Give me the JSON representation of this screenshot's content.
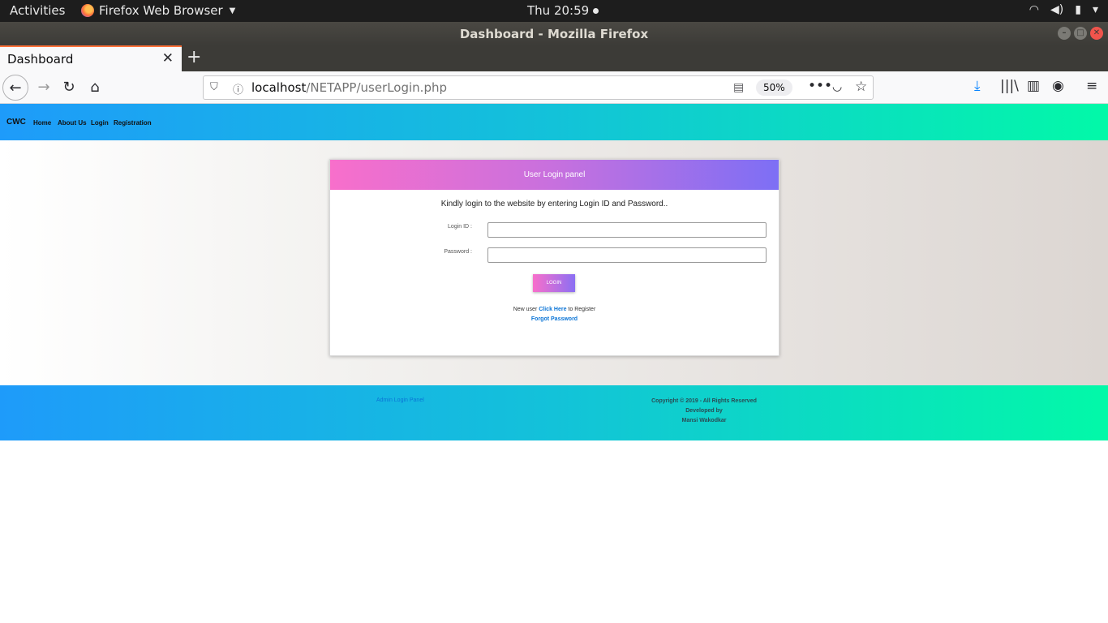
{
  "topbar": {
    "activities": "Activities",
    "app_name": "Firefox Web Browser",
    "clock": "Thu 20:59"
  },
  "window": {
    "title": "Dashboard - Mozilla Firefox"
  },
  "browser": {
    "tab_title": "Dashboard",
    "url_host": "localhost",
    "url_path": "/NETAPP/userLogin.php",
    "zoom": "50%"
  },
  "site": {
    "brand": "CWC",
    "nav": [
      "Home",
      "About Us",
      "Login",
      "Registration"
    ]
  },
  "login_panel": {
    "header": "User Login panel",
    "lead": "Kindly login to the website by entering Login ID and Password..",
    "login_id_label": "Login ID :",
    "login_id_value": "",
    "password_label": "Password :",
    "password_value": "",
    "login_button": "LOGIN",
    "new_user_prefix": "New user ",
    "click_here": "Click Here",
    "new_user_suffix": " to Register",
    "forgot_password": "Forgot Password"
  },
  "footer": {
    "admin_link": "Admin Login Panel",
    "copyright": "Copyright © 2019 - All Rights Reserved",
    "developed_by": "Developed by",
    "developer": "Mansi Wakodkar"
  },
  "colors": {
    "header_gradient_start": "#1e9bfa",
    "header_gradient_end": "#02f9a8",
    "panel_gradient_start": "#f86fcb",
    "panel_gradient_end": "#7d6ff5",
    "link": "#0a74d6"
  }
}
